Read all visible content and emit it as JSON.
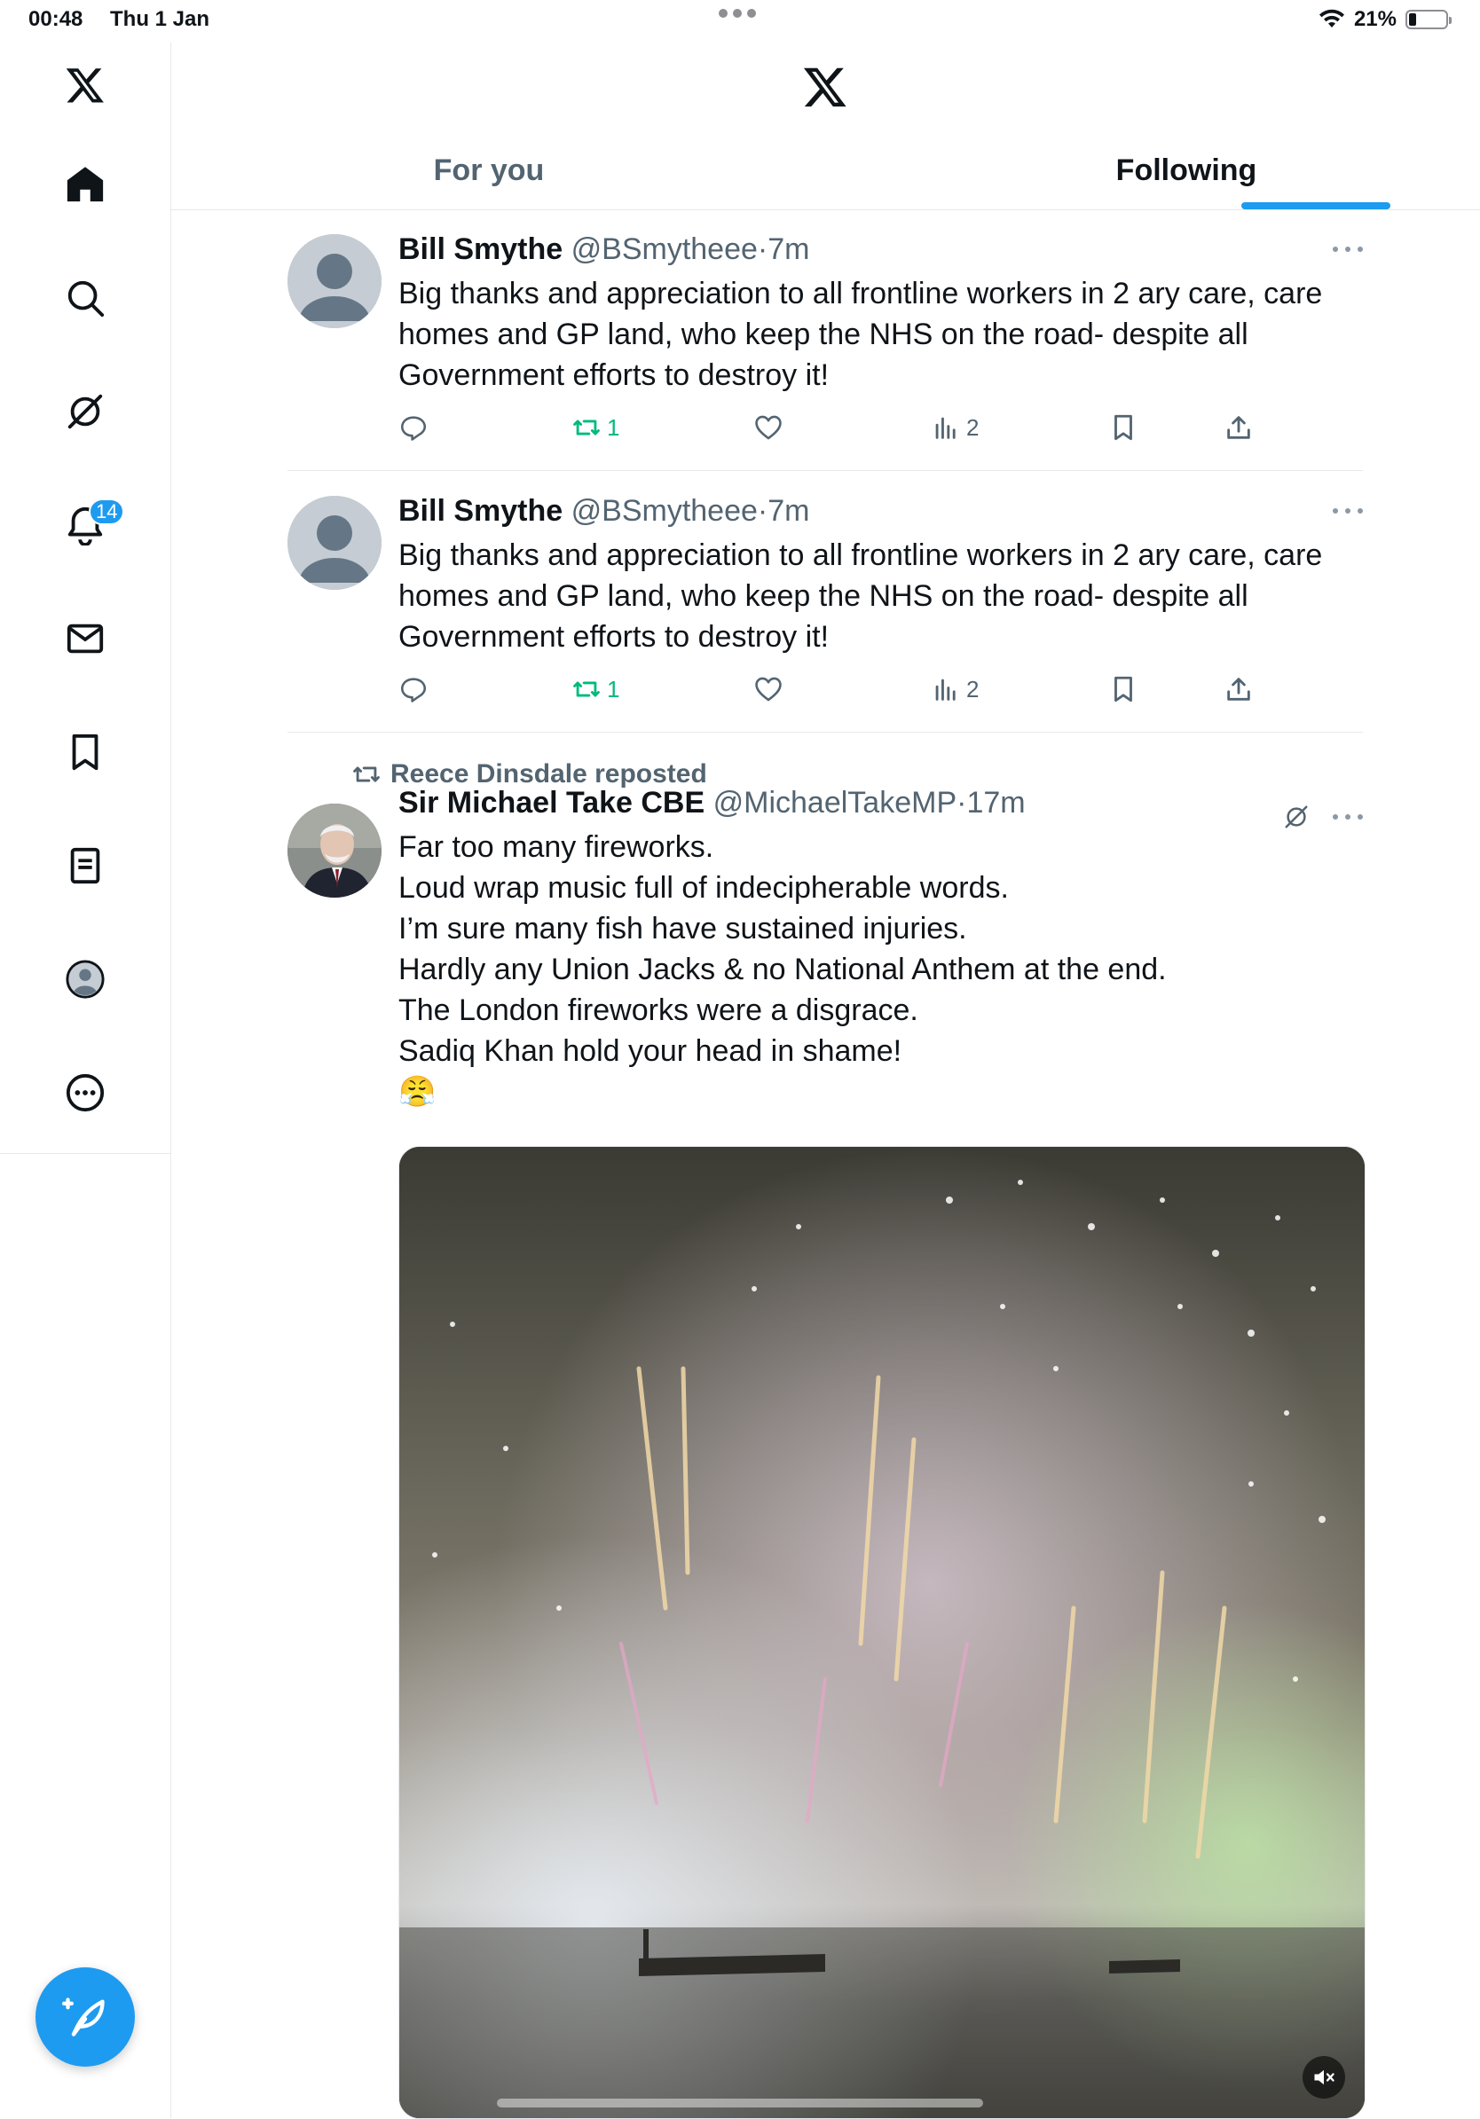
{
  "status_bar": {
    "time": "00:48",
    "date": "Thu 1 Jan",
    "battery": "21%",
    "battery_level": 0.21
  },
  "sidebar": {
    "items": [
      {
        "name": "logo",
        "icon": "x-logo-icon"
      },
      {
        "name": "home",
        "icon": "home-icon"
      },
      {
        "name": "search",
        "icon": "search-icon"
      },
      {
        "name": "grok",
        "icon": "grok-icon"
      },
      {
        "name": "notifications",
        "icon": "bell-icon",
        "badge": "14"
      },
      {
        "name": "messages",
        "icon": "mail-icon"
      },
      {
        "name": "bookmarks",
        "icon": "bookmark-icon"
      },
      {
        "name": "lists",
        "icon": "list-icon"
      },
      {
        "name": "profile",
        "icon": "profile-icon"
      },
      {
        "name": "more",
        "icon": "more-circle-icon"
      }
    ],
    "compose_icon": "compose-feather-icon"
  },
  "header": {
    "logo_icon": "x-logo-icon",
    "tabs": [
      {
        "label": "For you",
        "active": false
      },
      {
        "label": "Following",
        "active": true
      }
    ]
  },
  "colors": {
    "accent": "#1d9bf0",
    "retweet": "#00ba7c",
    "secondary_text": "#536471"
  },
  "tweets": [
    {
      "name": "Bill Smythe",
      "handle": "@BSmytheee",
      "sep": "·",
      "time": "7m",
      "lines": [
        "Big thanks and appreciation to all frontline workers in 2 ary care, care",
        "homes and GP land, who keep the NHS on the road- despite all",
        "Government efforts to destroy it!"
      ],
      "retweets": "1",
      "views": "2"
    },
    {
      "name": "Bill Smythe",
      "handle": "@BSmytheee",
      "sep": "·",
      "time": "7m",
      "lines": [
        "Big thanks and appreciation to all frontline workers in 2 ary care, care",
        "homes and GP land, who keep the NHS on the road- despite all",
        "Government efforts to destroy it!"
      ],
      "retweets": "1",
      "views": "2"
    },
    {
      "repost_by": "Reece Dinsdale reposted",
      "name": "Sir Michael Take CBE",
      "handle": "@MichaelTakeMP",
      "sep": "·",
      "time": "17m",
      "lines": [
        "Far too many fireworks.",
        "Loud wrap music full of indecipherable words.",
        "I’m sure many fish have sustained injuries.",
        "Hardly any Union Jacks & no National Anthem at the end.",
        "The London fireworks were a disgrace.",
        "Sadiq Khan hold your head in shame!",
        "😤"
      ],
      "media": "video of fireworks over the river",
      "media_control_icon": "mute-icon"
    }
  ]
}
